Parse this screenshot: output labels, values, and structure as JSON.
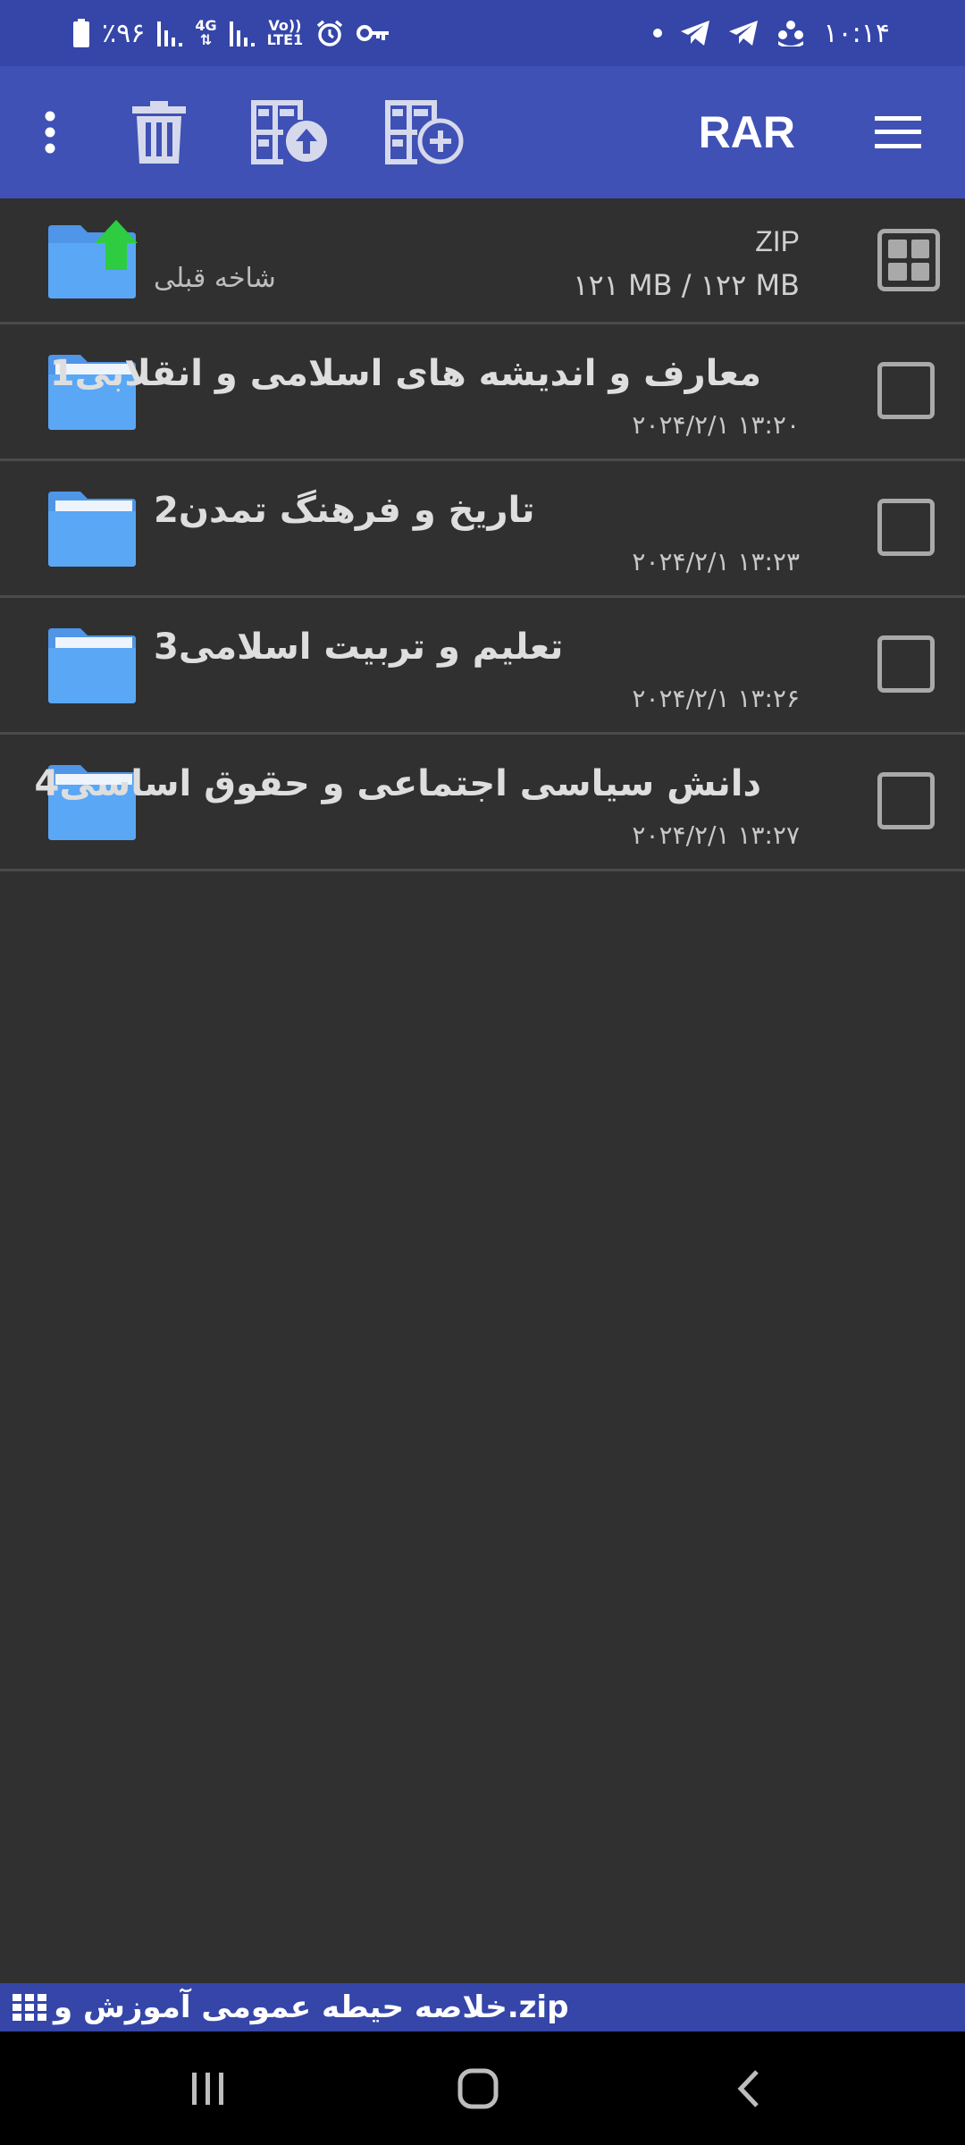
{
  "status_bar": {
    "battery": "٪۹۶",
    "net_4g": "4G",
    "volte_top": "Vo))",
    "volte_bottom": "LTE1",
    "time": "۱۰:۱۴",
    "icons": [
      "battery-icon",
      "signal-icon",
      "alarm-icon",
      "key-icon",
      "dot-icon",
      "telegram-icon",
      "telegram-icon",
      "app-icon"
    ]
  },
  "toolbar": {
    "title": "RAR",
    "actions": [
      "more-options-icon",
      "delete-icon",
      "extract-icon",
      "add-archive-icon",
      "menu-icon"
    ]
  },
  "archive_header": {
    "parent_label": "شاخه قبلی",
    "type": "ZIP",
    "size": "۱۲۱ MB / ۱۲۲ MB"
  },
  "files": [
    {
      "name": "معارف و اندیشه های اسلامی و انقلابی1",
      "date": "۲۰۲۴/۲/۱ ۱۳:۲۰"
    },
    {
      "name": "تاریخ و فرهنگ تمدن2",
      "date": "۲۰۲۴/۲/۱ ۱۳:۲۳"
    },
    {
      "name": "تعلیم و تربیت اسلامی3",
      "date": "۲۰۲۴/۲/۱ ۱۳:۲۶"
    },
    {
      "name": "دانش سیاسی اجتماعی و حقوق اساسی4",
      "date": "۲۰۲۴/۲/۱ ۱۳:۲۷"
    }
  ],
  "path_bar": {
    "text": "خلاصه حیطه عمومی آموزش و.zip"
  },
  "colors": {
    "status_bar": "#3546a8",
    "toolbar": "#3f51b5",
    "background": "#303030",
    "folder": "#5aa7f5",
    "up_arrow": "#2ecc40"
  }
}
